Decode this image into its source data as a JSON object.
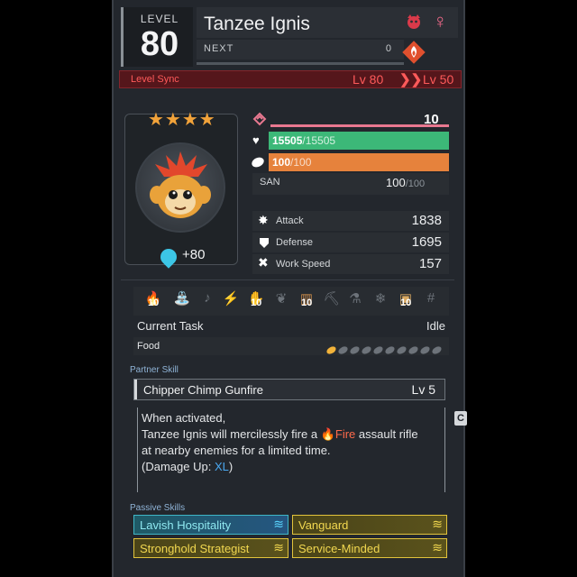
{
  "header": {
    "level_label": "LEVEL",
    "level": "80",
    "name": "Tanzee Ignis",
    "next_label": "NEXT",
    "next_value": "0",
    "gender_symbol": "♀"
  },
  "level_sync": {
    "label": "Level Sync",
    "from": "Lv 80",
    "arrow": "❯❯",
    "to": "Lv 50"
  },
  "portrait": {
    "stars": "★★★★",
    "soul_bonus": "+80"
  },
  "stats": {
    "trust": "10",
    "hp_current": "15505",
    "hp_max": "/15505",
    "hp_fraction": 1.0,
    "hunger_current": "100",
    "hunger_max": "/100",
    "hunger_fraction": 1.0,
    "san_label": "SAN",
    "san_current": "100",
    "san_max": "/100",
    "attack_label": "Attack",
    "attack": "1838",
    "defense_label": "Defense",
    "defense": "1695",
    "workspeed_label": "Work Speed",
    "workspeed": "157"
  },
  "work": {
    "levels": [
      "10",
      "10",
      "10",
      "10"
    ]
  },
  "task": {
    "label": "Current Task",
    "value": "Idle"
  },
  "food": {
    "label": "Food",
    "filled": 1,
    "total": 10
  },
  "partner_skill": {
    "section": "Partner Skill",
    "name": "Chipper Chimp Gunfire",
    "level": "Lv 5",
    "line1": "When activated,",
    "line2a": "Tanzee Ignis will mercilessly fire a",
    "line2b": "Fire",
    "line2c": "assault rifle",
    "line3": "at nearby enemies for a limited time.",
    "line4a": "(Damage Up:",
    "line4b": "XL",
    "line4c": ")"
  },
  "passives": {
    "section": "Passive Skills",
    "items": [
      {
        "label": "Lavish Hospitality",
        "color": "#3fb6c6"
      },
      {
        "label": "Vanguard",
        "color": "#e2c43c"
      },
      {
        "label": "Stronghold Strategist",
        "color": "#e2c43c"
      },
      {
        "label": "Service-Minded",
        "color": "#e2c43c"
      }
    ]
  },
  "side_tab": "C",
  "colors": {
    "accent_red": "#ff5a5a",
    "hp_green": "#3cb878",
    "hunger_orange": "#e6823c",
    "trust_pink": "#e87890"
  }
}
